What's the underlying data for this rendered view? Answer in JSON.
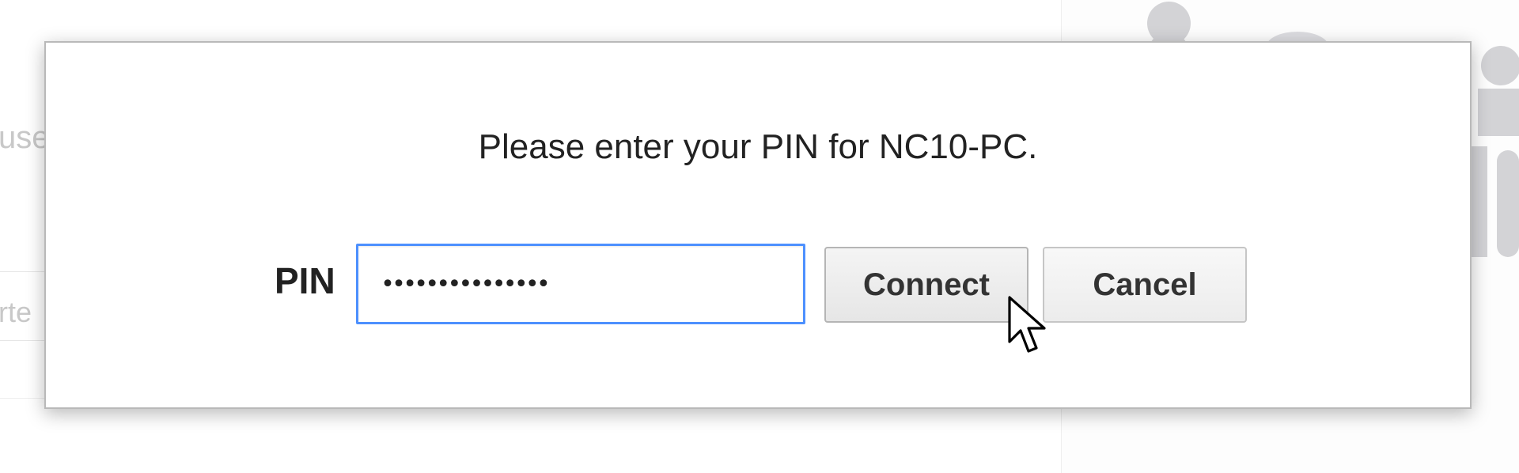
{
  "background": {
    "left_text_1": "use",
    "left_text_2": "rte"
  },
  "dialog": {
    "message": "Please enter your PIN for NC10-PC.",
    "pin_label": "PIN",
    "pin_value": "•••••••••••••••",
    "connect_label": "Connect",
    "cancel_label": "Cancel"
  },
  "colors": {
    "focus_border": "#4d90fe",
    "dialog_border": "#b9b9b9",
    "text": "#222222"
  },
  "icons": {
    "cursor": "arrow-pointer-icon"
  }
}
